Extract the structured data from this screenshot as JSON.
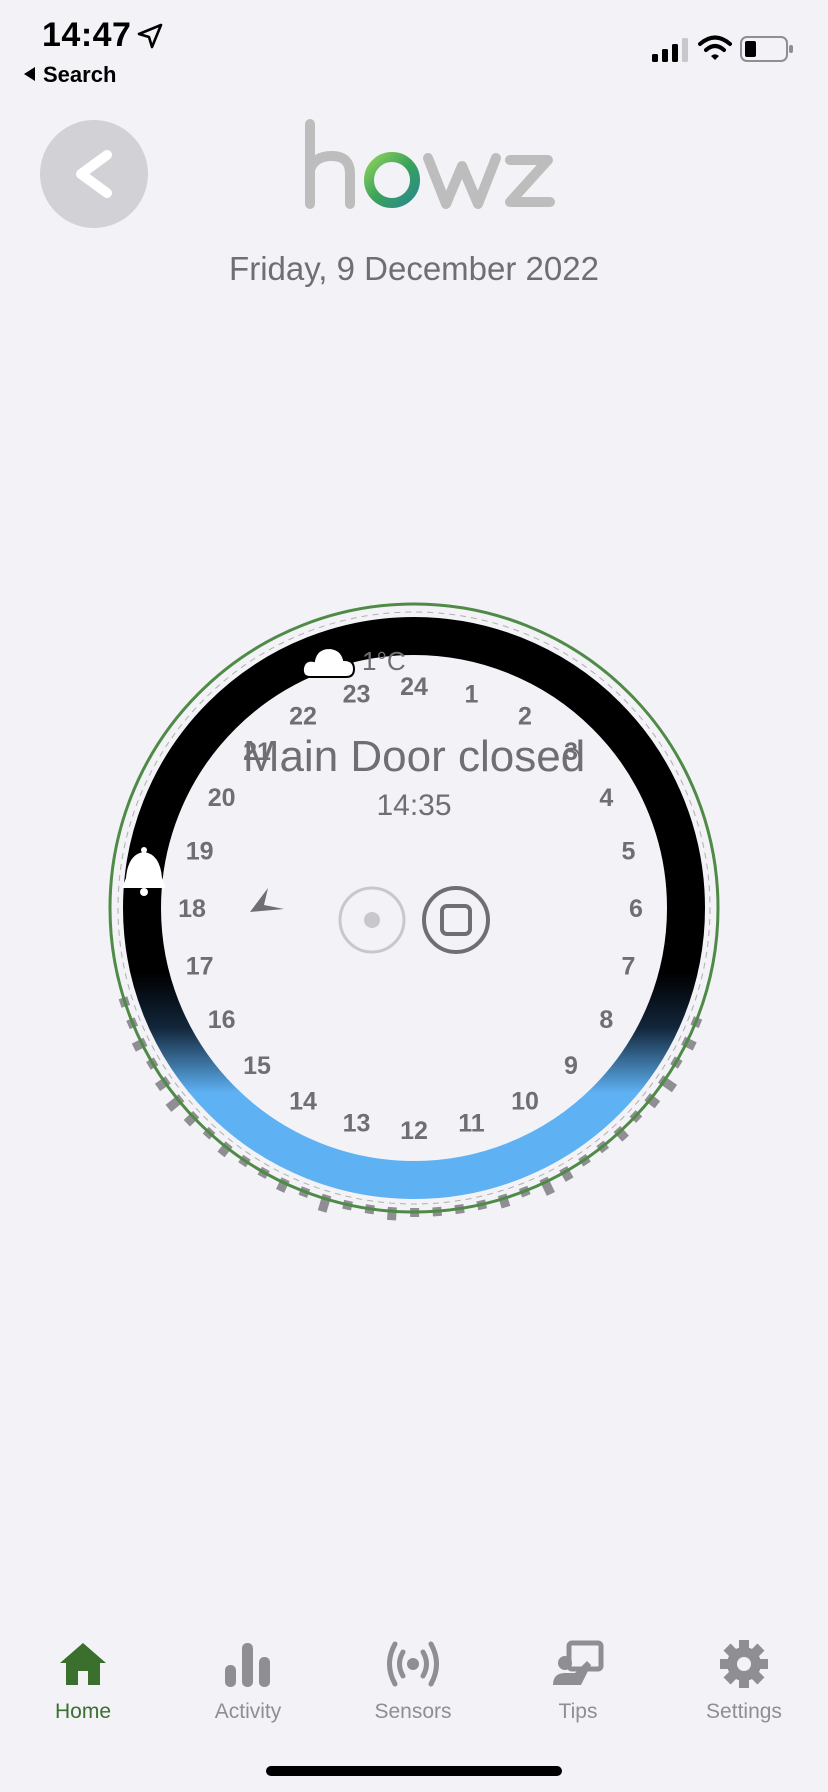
{
  "status_bar": {
    "time": "14:47",
    "back_app": "Search"
  },
  "header": {
    "logo_text": "howz",
    "date": "Friday, 9 December 2022"
  },
  "dial": {
    "hours": [
      "24",
      "1",
      "2",
      "3",
      "4",
      "5",
      "6",
      "7",
      "8",
      "9",
      "10",
      "11",
      "12",
      "13",
      "14",
      "15",
      "16",
      "17",
      "18",
      "19",
      "20",
      "21",
      "22",
      "23"
    ],
    "weather_temp": "1°C",
    "status_text": "Main Door closed",
    "status_time": "14:35",
    "colors": {
      "ring": "#000000",
      "daylight": "#5eb1f3",
      "outline": "#4f8a46",
      "activity": "#8e8e93"
    }
  },
  "tabbar": {
    "items": [
      {
        "label": "Home",
        "icon": "home-icon",
        "active": true
      },
      {
        "label": "Activity",
        "icon": "activity-icon",
        "active": false
      },
      {
        "label": "Sensors",
        "icon": "sensors-icon",
        "active": false
      },
      {
        "label": "Tips",
        "icon": "tips-icon",
        "active": false
      },
      {
        "label": "Settings",
        "icon": "settings-icon",
        "active": false
      }
    ],
    "active_color": "#3a6f2e",
    "inactive_color": "#8e8e93"
  }
}
